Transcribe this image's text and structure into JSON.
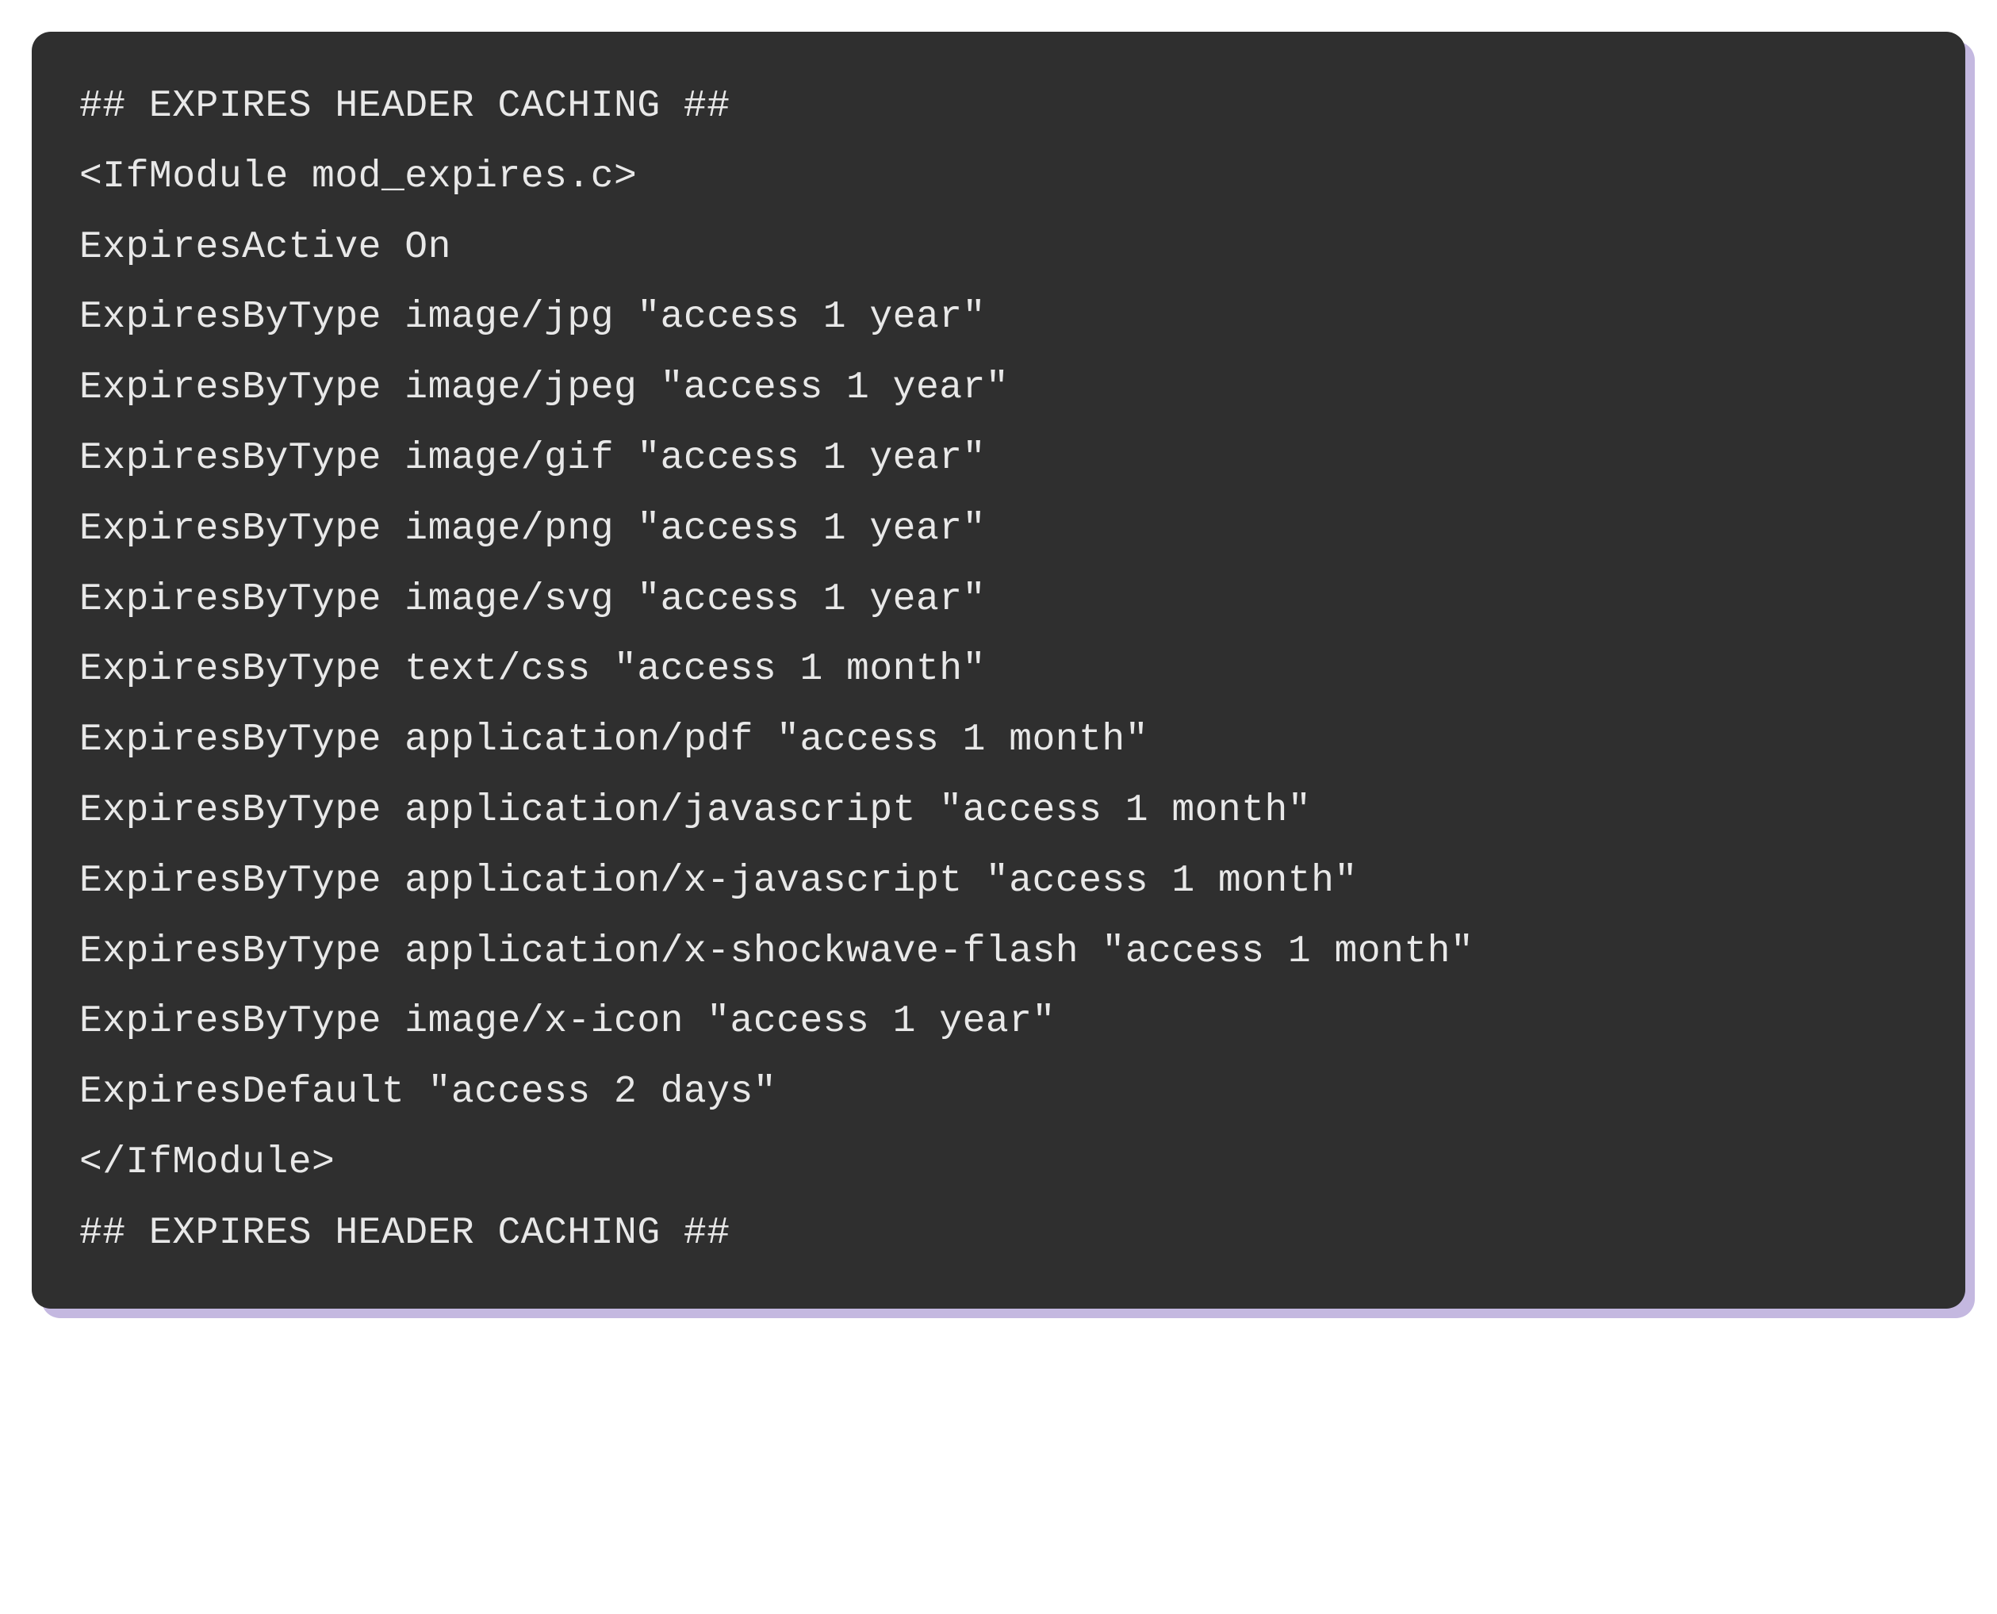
{
  "code": {
    "lines": [
      "## EXPIRES HEADER CACHING ##",
      "<IfModule mod_expires.c>",
      "ExpiresActive On",
      "ExpiresByType image/jpg \"access 1 year\"",
      "ExpiresByType image/jpeg \"access 1 year\"",
      "ExpiresByType image/gif \"access 1 year\"",
      "ExpiresByType image/png \"access 1 year\"",
      "ExpiresByType image/svg \"access 1 year\"",
      "ExpiresByType text/css \"access 1 month\"",
      "ExpiresByType application/pdf \"access 1 month\"",
      "ExpiresByType application/javascript \"access 1 month\"",
      "ExpiresByType application/x-javascript \"access 1 month\"",
      "ExpiresByType application/x-shockwave-flash \"access 1 month\"",
      "ExpiresByType image/x-icon \"access 1 year\"",
      "ExpiresDefault \"access 2 days\"",
      "</IfModule>",
      "## EXPIRES HEADER CACHING ##"
    ]
  }
}
